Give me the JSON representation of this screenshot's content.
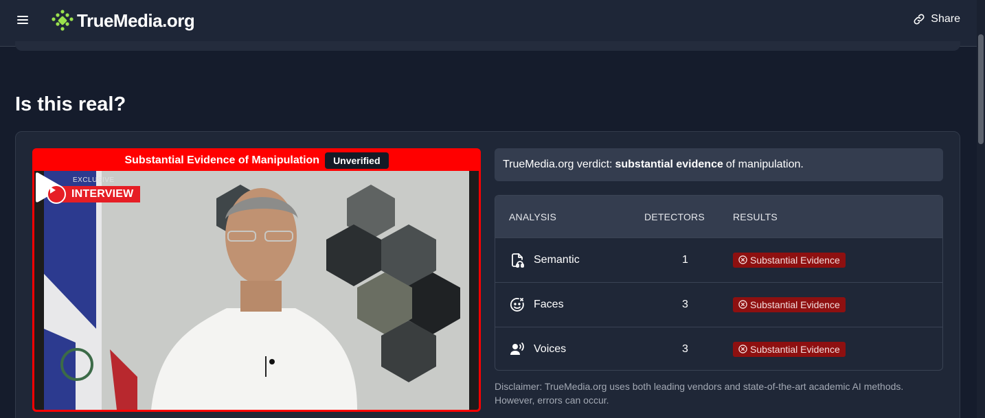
{
  "header": {
    "logo_text": "TrueMedia.org",
    "share_label": "Share"
  },
  "page": {
    "title": "Is this real?"
  },
  "video": {
    "banner_text": "Substantial Evidence of Manipulation",
    "badge": "Unverified",
    "overlay_small": "EXCLUSIVE",
    "overlay_label": "INTERVIEW"
  },
  "verdict": {
    "prefix": "TrueMedia.org verdict:",
    "emphasis": "substantial evidence",
    "suffix": "of manipulation."
  },
  "analysis": {
    "headers": {
      "analysis": "ANALYSIS",
      "detectors": "DETECTORS",
      "results": "RESULTS"
    },
    "rows": [
      {
        "name": "Semantic",
        "icon": "semantic-icon",
        "detectors": "1",
        "result": "Substantial Evidence"
      },
      {
        "name": "Faces",
        "icon": "faces-icon",
        "detectors": "3",
        "result": "Substantial Evidence"
      },
      {
        "name": "Voices",
        "icon": "voices-icon",
        "detectors": "3",
        "result": "Substantial Evidence"
      }
    ]
  },
  "disclaimer": "Disclaimer: TrueMedia.org uses both leading vendors and state-of-the-art academic AI methods. However, errors can occur.",
  "colors": {
    "manipulation_red": "#ff0000",
    "evidence_pill": "#8e1010",
    "logo_green": "#9be14d"
  }
}
